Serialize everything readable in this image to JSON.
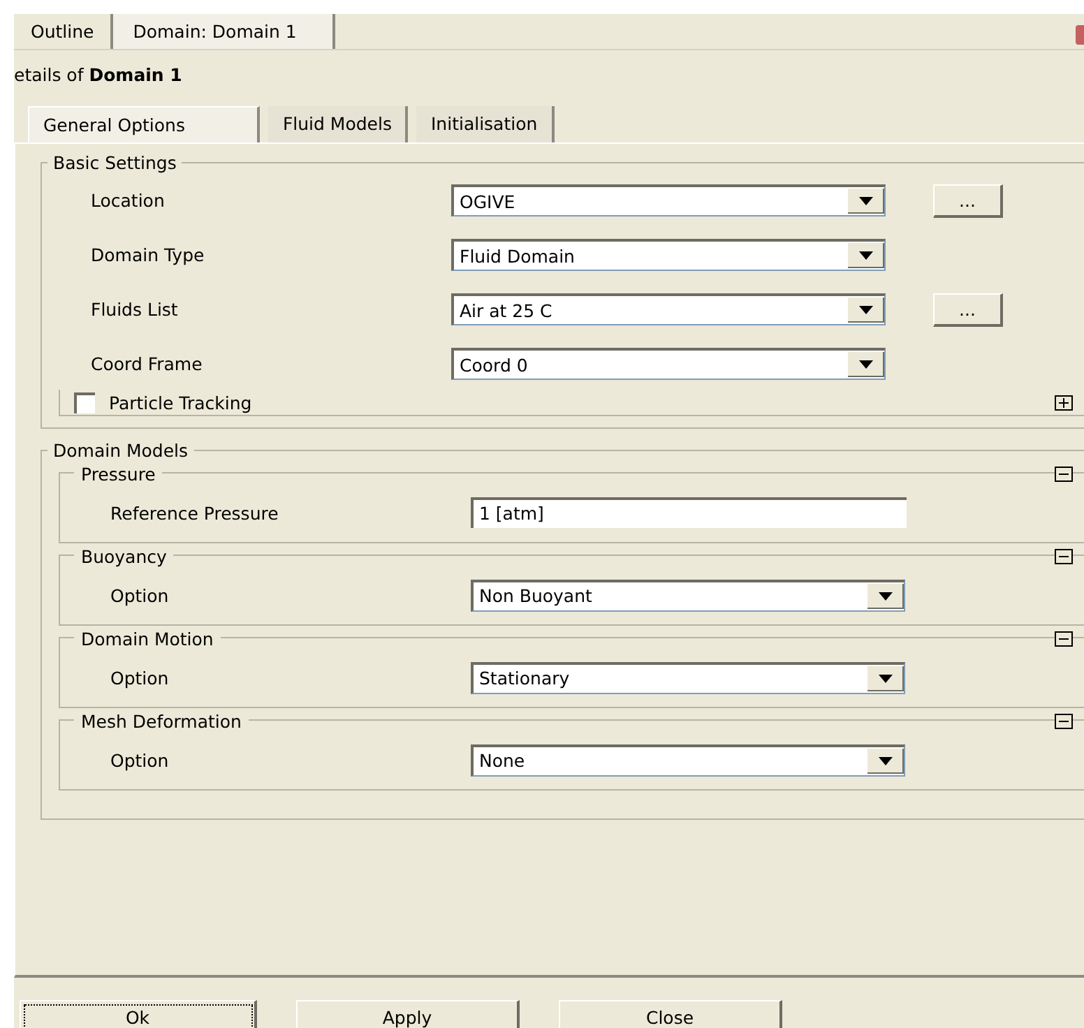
{
  "top_tabs": [
    {
      "label": "Outline",
      "selected": false
    },
    {
      "label": "Domain: Domain 1",
      "selected": true
    }
  ],
  "details_title": "etails of **Domain 1**",
  "tabs": [
    {
      "label": "General Options",
      "selected": true
    },
    {
      "label": "Fluid Models",
      "selected": false
    },
    {
      "label": "Initialisation",
      "selected": false
    }
  ],
  "basic_settings": {
    "title": "Basic Settings",
    "fields": [
      {
        "kind": "dropdown",
        "label": "Location",
        "value": "OGIVE",
        "browse": "..."
      },
      {
        "kind": "dropdown",
        "label": "Domain Type",
        "value": "Fluid Domain"
      },
      {
        "kind": "dropdown",
        "label": "Fluids List",
        "value": "Air at 25 C",
        "browse": "..."
      },
      {
        "kind": "dropdown",
        "label": "Coord Frame",
        "value": "Coord 0"
      }
    ],
    "particle_tracking": {
      "label": "Particle Tracking",
      "checked": false,
      "expanded": false
    }
  },
  "domain_models": {
    "title": "Domain Models",
    "sections": [
      {
        "title": "Pressure",
        "expanded": true,
        "fields": [
          {
            "kind": "text",
            "label": "Reference Pressure",
            "value": "1 [atm]"
          }
        ]
      },
      {
        "title": "Buoyancy",
        "expanded": true,
        "fields": [
          {
            "kind": "dropdown",
            "label": "Option",
            "value": "Non Buoyant"
          }
        ]
      },
      {
        "title": "Domain Motion",
        "expanded": true,
        "fields": [
          {
            "kind": "dropdown",
            "label": "Option",
            "value": "Stationary"
          }
        ]
      },
      {
        "title": "Mesh Deformation",
        "expanded": true,
        "fields": [
          {
            "kind": "dropdown",
            "label": "Option",
            "value": "None"
          }
        ]
      }
    ]
  },
  "buttons": [
    "Ok",
    "Apply",
    "Close"
  ]
}
